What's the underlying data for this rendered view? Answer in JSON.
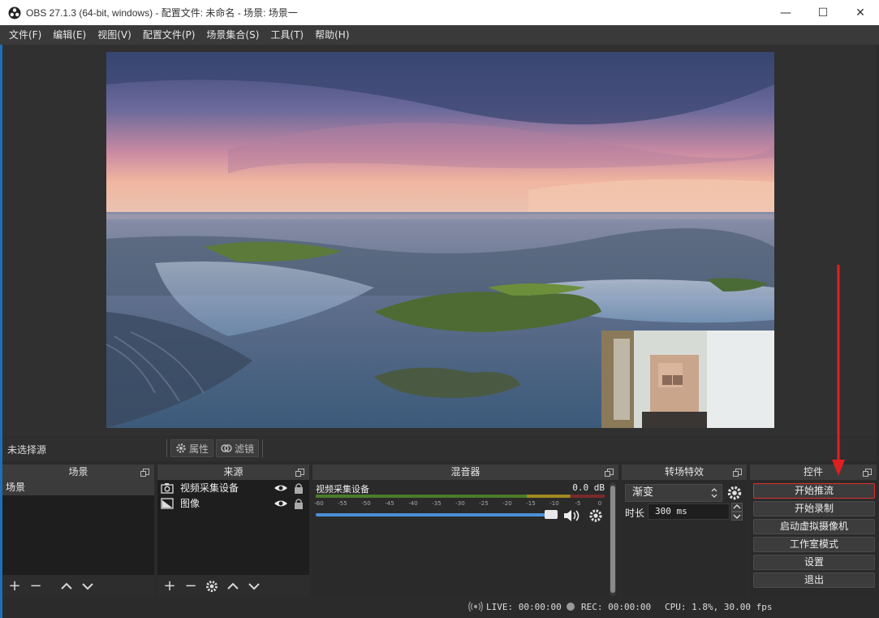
{
  "window": {
    "title": "OBS 27.1.3 (64-bit, windows) - 配置文件: 未命名 - 场景: 场景一",
    "minimize": "—",
    "maximize": "☐",
    "close": "✕"
  },
  "menu": [
    "文件(F)",
    "编辑(E)",
    "视图(V)",
    "配置文件(P)",
    "场景集合(S)",
    "工具(T)",
    "帮助(H)"
  ],
  "source_toolbar": {
    "no_source": "未选择源",
    "properties": "属性",
    "filters": "滤镜"
  },
  "scenes": {
    "title": "场景",
    "items": [
      "场景"
    ]
  },
  "sources": {
    "title": "来源",
    "items": [
      {
        "name": "视频采集设备",
        "icon": "camera-icon"
      },
      {
        "name": "图像",
        "icon": "image-icon"
      }
    ]
  },
  "mixer": {
    "title": "混音器",
    "channel_name": "视频采集设备",
    "level": "0.0 dB",
    "ticks": [
      "-60",
      "-55",
      "-50",
      "-45",
      "-40",
      "-35",
      "-30",
      "-25",
      "-20",
      "-15",
      "-10",
      "-5",
      "0"
    ]
  },
  "transitions": {
    "title": "转场特效",
    "selected": "渐变",
    "duration_label": "时长",
    "duration_value": "300 ms"
  },
  "controls": {
    "title": "控件",
    "buttons": [
      "开始推流",
      "开始录制",
      "启动虚拟摄像机",
      "工作室模式",
      "设置",
      "退出"
    ]
  },
  "status": {
    "live": "LIVE: 00:00:00",
    "rec": "REC: 00:00:00",
    "cpu": "CPU: 1.8%, 30.00 fps"
  },
  "colors": {
    "accent_blue": "#4a90d9",
    "highlight_red": "#e03030"
  }
}
